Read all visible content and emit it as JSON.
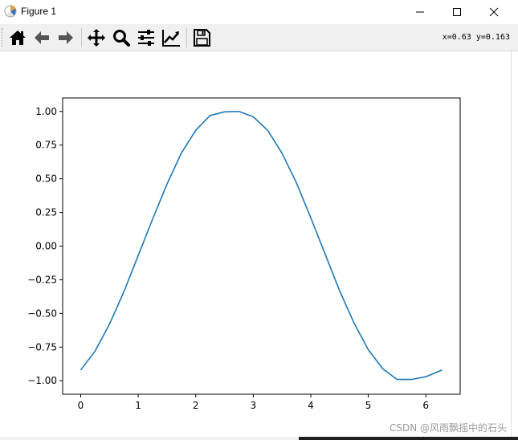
{
  "window": {
    "title": "Figure 1",
    "minimize_glyph": "—",
    "maximize_glyph": "☐",
    "close_glyph": "✕"
  },
  "toolbar": {
    "tools": [
      {
        "name": "home",
        "icon": "home-icon"
      },
      {
        "name": "back",
        "icon": "back-arrow-icon"
      },
      {
        "name": "forward",
        "icon": "forward-arrow-icon"
      },
      {
        "name": "pan",
        "icon": "move-icon"
      },
      {
        "name": "zoom",
        "icon": "magnifier-icon"
      },
      {
        "name": "subplots",
        "icon": "sliders-icon"
      },
      {
        "name": "axes-edit",
        "icon": "line-chart-icon"
      },
      {
        "name": "save",
        "icon": "floppy-disk-icon"
      }
    ],
    "coords": "x=0.63 y=0.163"
  },
  "chart_data": {
    "type": "line",
    "series": [
      {
        "color": "#1f77b4",
        "x": [
          0,
          0.25,
          0.5,
          0.75,
          1.0,
          1.25,
          1.5,
          1.75,
          2.0,
          2.25,
          2.5,
          2.75,
          3.0,
          3.25,
          3.5,
          3.75,
          4.0,
          4.25,
          4.5,
          4.75,
          5.0,
          5.25,
          5.5,
          5.75,
          6.0,
          6.283
        ],
        "y": [
          -0.92,
          -0.78,
          -0.58,
          -0.34,
          -0.07,
          0.2,
          0.46,
          0.69,
          0.86,
          0.97,
          0.997,
          1.0,
          0.96,
          0.86,
          0.69,
          0.47,
          0.21,
          -0.06,
          -0.33,
          -0.57,
          -0.77,
          -0.91,
          -0.99,
          -0.99,
          -0.97,
          -0.92
        ]
      }
    ],
    "xticks": [
      "0",
      "1",
      "2",
      "3",
      "4",
      "5",
      "6"
    ],
    "xtick_values": [
      0,
      1,
      2,
      3,
      4,
      5,
      6
    ],
    "yticks": [
      "−1.00",
      "−0.75",
      "−0.50",
      "−0.25",
      "0.00",
      "0.25",
      "0.50",
      "0.75",
      "1.00"
    ],
    "ytick_values": [
      -1.0,
      -0.75,
      -0.5,
      -0.25,
      0.0,
      0.25,
      0.5,
      0.75,
      1.0
    ],
    "xlim": [
      -0.3142,
      6.5973
    ],
    "ylim": [
      -1.1,
      1.1
    ],
    "grid": false
  },
  "watermark": "CSDN @风雨飘摇中的石头"
}
